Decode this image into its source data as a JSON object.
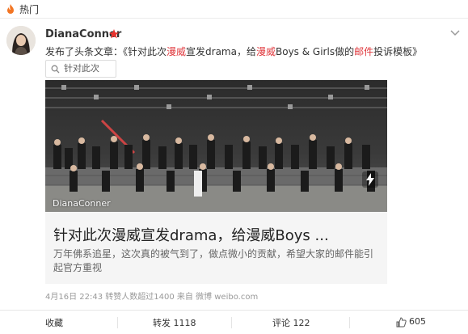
{
  "topbar": {
    "label": "热门"
  },
  "post": {
    "username": "DianaConner",
    "text_prefix": "发布了头条文章：《针对此次",
    "text_red1": "漫威",
    "text_mid1": "宣发drama，给",
    "text_red2": "漫威",
    "text_mid2": "Boys & Girls做的",
    "text_red3": "邮件",
    "text_suffix": "投诉模板》",
    "search_chip": "针对此次漫..."
  },
  "card": {
    "watermark": "DianaConner",
    "title": "针对此次漫威宣发drama，给漫威Boys ...",
    "summary": "万年佛系追星，这次真的被气到了，做点微小的贡献，希望大家的邮件能引起官方重视"
  },
  "meta": {
    "text": "4月16日 22:43 转赞人数超过1400 来自 微博 weibo.com"
  },
  "actions": {
    "favorite": "收藏",
    "repost": "转发 1118",
    "comment": "评论 122",
    "like": "605"
  },
  "colors": {
    "accent_red": "#e0393e",
    "vip_star": "#e8322d"
  }
}
